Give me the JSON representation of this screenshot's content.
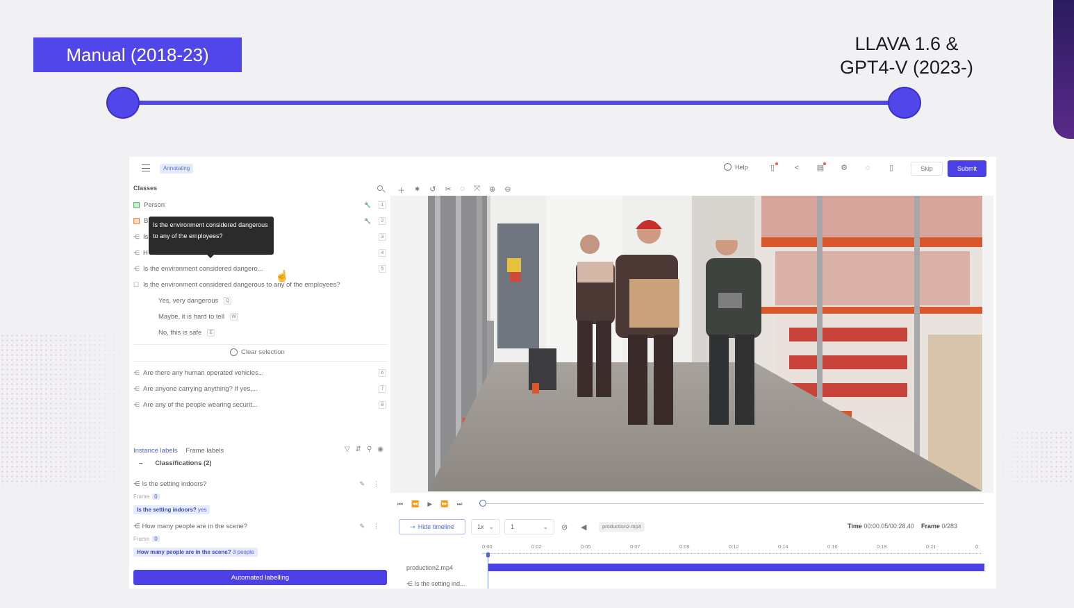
{
  "slide": {
    "left_label": "Manual (2018-23)",
    "right_label_line1": "LLAVA 1.6 &",
    "right_label_line2": "GPT4-V (2023-)"
  },
  "topbar": {
    "status_badge": "Annotating",
    "help_label": "Help",
    "skip_label": "Skip",
    "submit_label": "Submit"
  },
  "classes": {
    "header": "Classes",
    "items": [
      {
        "label": "Person",
        "key": "1",
        "color": "#56b36b"
      },
      {
        "label": "B",
        "key": "2",
        "color": "#e8864a"
      },
      {
        "label": "Is",
        "key": "3"
      },
      {
        "label": "H",
        "key": "4"
      },
      {
        "label": "Is the environment considered dangero...",
        "key": "5"
      }
    ],
    "tooltip": "Is the environment considered dangerous to any of the employees?",
    "expanded_question": "Is the environment considered dangerous to any of the employees?",
    "options": [
      {
        "label": "Yes, very dangerous",
        "key": "Q"
      },
      {
        "label": "Maybe, it is hard to tell",
        "key": "W"
      },
      {
        "label": "No, this is safe",
        "key": "E"
      }
    ],
    "clear_selection": "Clear selection",
    "more": [
      {
        "label": "Are there any human operated vehicles...",
        "key": "6"
      },
      {
        "label": "Are anyone carrying anything? If yes,...",
        "key": "7"
      },
      {
        "label": "Are any of the people wearing securit...",
        "key": "8"
      }
    ]
  },
  "labels": {
    "tab_instance": "Instance labels",
    "tab_frame": "Frame labels",
    "classifications_header": "Classifications (2)",
    "frame_word": "Frame",
    "entries": [
      {
        "question": "Is the setting indoors?",
        "frame": "0",
        "answer_q": "Is the setting indoors?",
        "answer": "yes"
      },
      {
        "question": "How many people are in the scene?",
        "frame": "0",
        "answer_q": "How many people are in the scene?",
        "answer": "3 people"
      }
    ],
    "automated_button": "Automated labelling"
  },
  "player": {
    "hide_timeline": "Hide timeline",
    "speed": "1x",
    "step": "1",
    "file_name": "production2.mp4",
    "time_label": "Time",
    "time_value": "00:00.05/00:28.40",
    "frame_label": "Frame",
    "frame_value": "0/283",
    "ruler": [
      "0:00",
      "0:02",
      "0:05",
      "0:07",
      "0:09",
      "0:12",
      "0:14",
      "0:16",
      "0:19",
      "0:21",
      "0:"
    ],
    "track_file": "production2.mp4",
    "track_question": "Is the setting ind..."
  },
  "colors": {
    "accent": "#5046ea",
    "submit": "#4b40e6"
  }
}
